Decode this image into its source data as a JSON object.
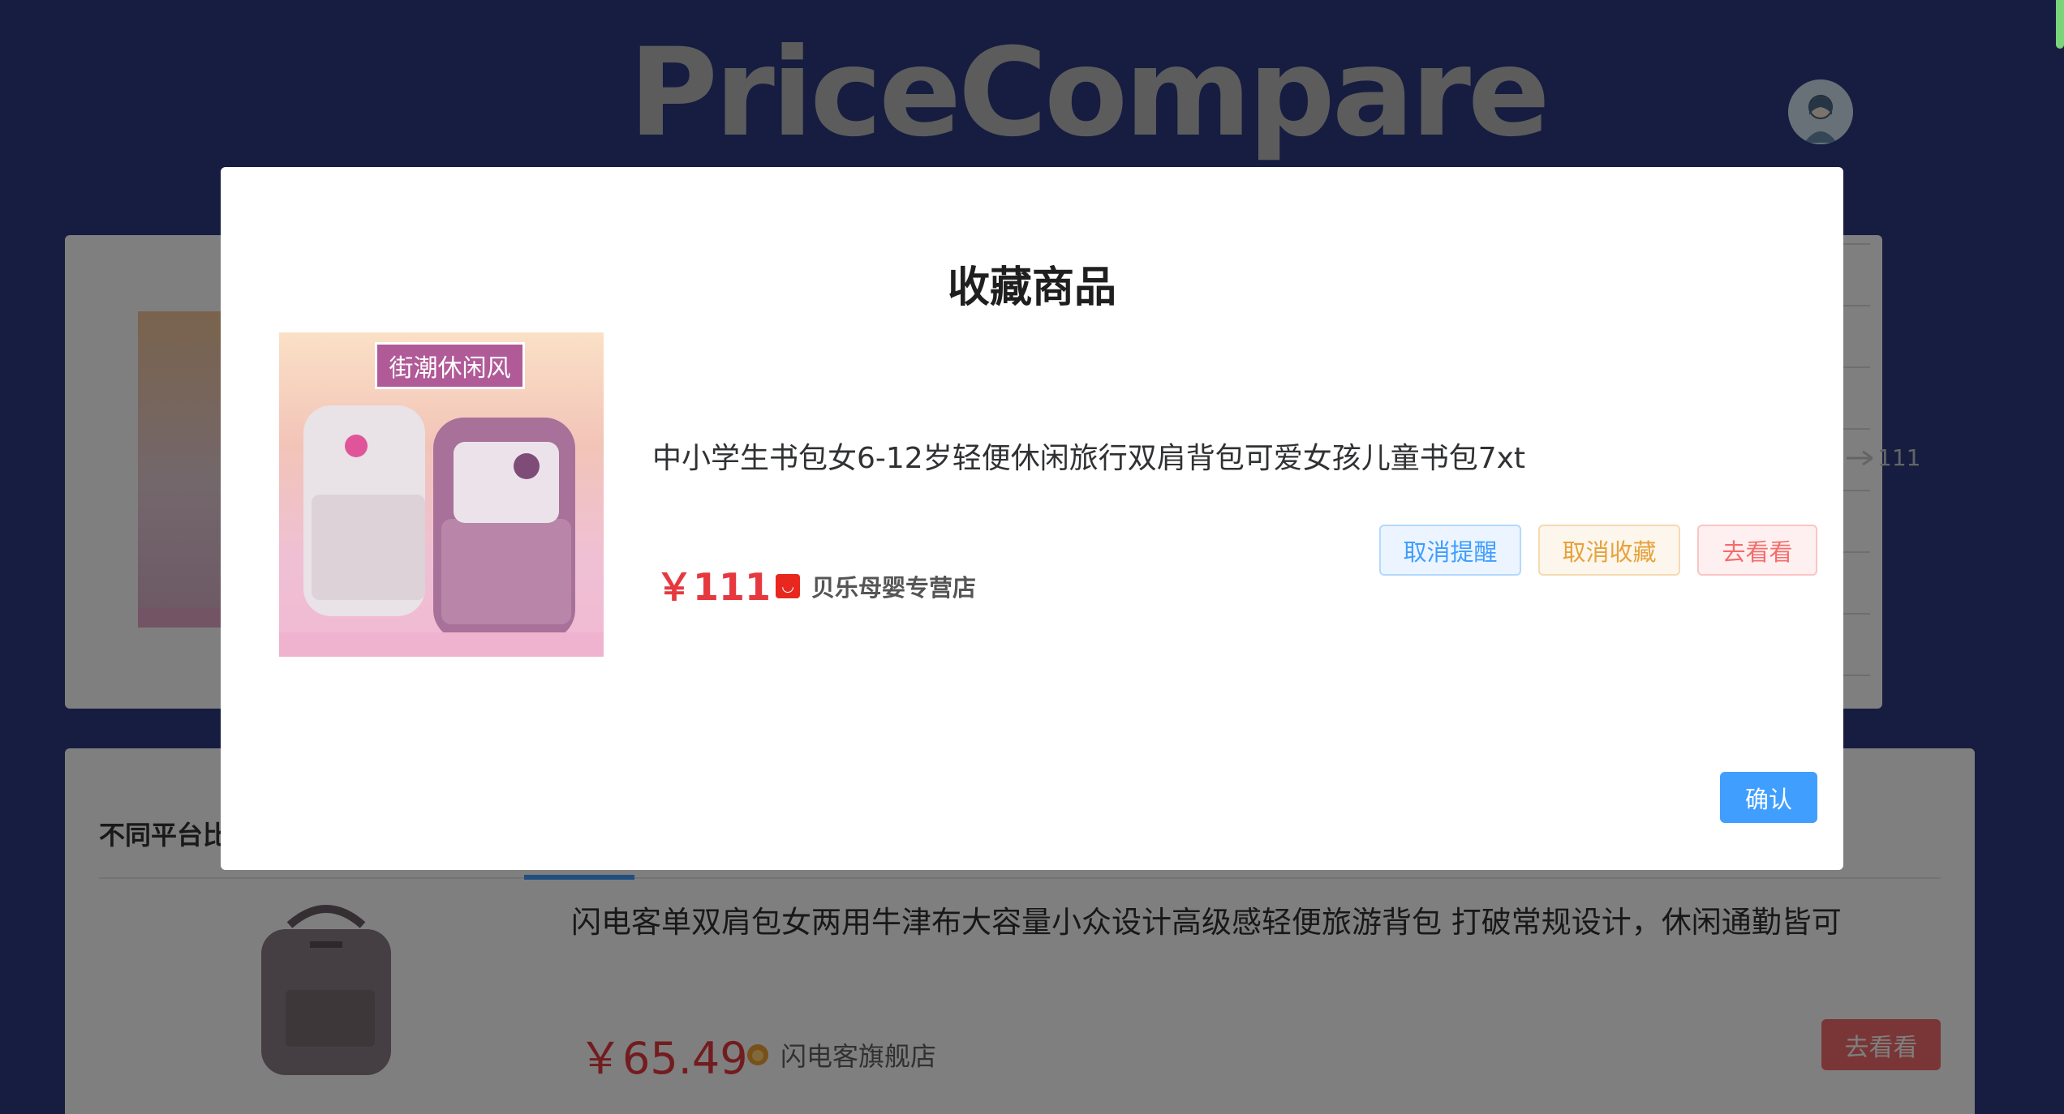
{
  "app": {
    "logo_text": "PriceCompare"
  },
  "background": {
    "chart_tick_label": "111",
    "compare_section": {
      "title": "不同平台比",
      "item": {
        "name": "闪电客单双肩包女两用牛津布大容量小众设计高级感轻便旅游背包 打破常规设计，休闲通勤皆可",
        "price": "￥65.49",
        "shop": "闪电客旗舰店",
        "view_label": "去看看"
      }
    }
  },
  "dialog": {
    "title": "收藏商品",
    "product": {
      "image_banner": "街潮休闲风",
      "name": "中小学生书包女6-12岁轻便休闲旅行双肩背包可爱女孩儿童书包7xt",
      "price": "￥111",
      "shop": "贝乐母婴专营店"
    },
    "actions": {
      "cancel_reminder": "取消提醒",
      "cancel_favorite": "取消收藏",
      "view": "去看看"
    },
    "confirm_label": "确认"
  },
  "colors": {
    "page_bg": "#2d3a82",
    "price_red": "#e6393f",
    "primary_blue": "#409eff",
    "warning_orange": "#e6a23c",
    "danger_red": "#f56c6c"
  },
  "icons": {
    "shop_icon": "tmall-shop-icon",
    "avatar": "user-avatar-icon",
    "store_icon": "lion-store-icon"
  }
}
